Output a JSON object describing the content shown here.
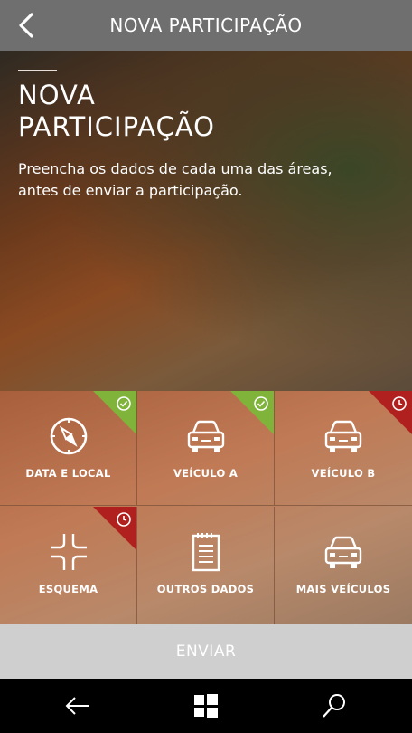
{
  "header": {
    "title": "NOVA PARTICIPAÇÃO",
    "back_icon": "chevron-left-icon"
  },
  "hero": {
    "title": "NOVA\nPARTICIPAÇÃO",
    "description": "Preencha os dados de cada uma das áreas, antes de enviar a participação."
  },
  "tiles": [
    {
      "label": "DATA E LOCAL",
      "icon": "compass-icon",
      "status": "complete",
      "status_color": "#7fb33a"
    },
    {
      "label": "VEÍCULO A",
      "icon": "car-icon",
      "status": "complete",
      "status_color": "#7fb33a"
    },
    {
      "label": "VEÍCULO B",
      "icon": "car-icon",
      "status": "pending",
      "status_color": "#b0201e"
    },
    {
      "label": "ESQUEMA",
      "icon": "crossroad-icon",
      "status": "pending",
      "status_color": "#b0201e"
    },
    {
      "label": "OUTROS DADOS",
      "icon": "notepad-icon",
      "status": "none"
    },
    {
      "label": "MAIS VEÍCULOS",
      "icon": "car-icon",
      "status": "none"
    }
  ],
  "submit": {
    "label": "ENVIAR"
  },
  "system_nav": {
    "back": "back-arrow-icon",
    "home": "windows-logo-icon",
    "search": "search-icon"
  }
}
